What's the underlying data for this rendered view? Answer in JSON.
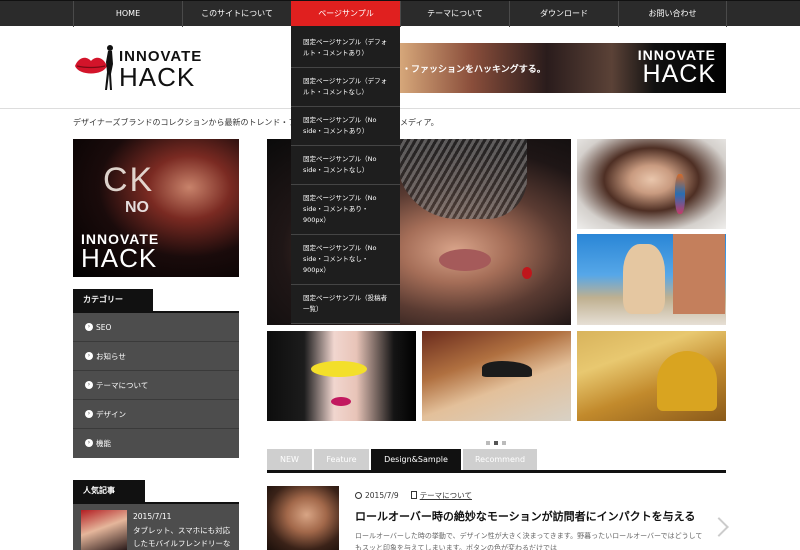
{
  "nav": {
    "items": [
      "HOME",
      "このサイトについて",
      "ページサンプル",
      "テーマについて",
      "ダウンロード",
      "お問い合わせ"
    ]
  },
  "dropdown": {
    "items": [
      "固定ページサンプル（デフォルト・コメントあり）",
      "固定ページサンプル（デフォルト・コメントなし）",
      "固定ページサンプル（No side・コメントあり）",
      "固定ページサンプル（No side・コメントなし）",
      "固定ページサンプル（No side・コメントあり・900px）",
      "固定ページサンプル（No side・コメントなし・900px）",
      "固定ページサンプル（投稿者一覧）"
    ]
  },
  "header": {
    "logo_line1": "INNOVATE",
    "logo_line2": "HACK",
    "banner_tagline": "・ファッションをハッキングする。",
    "banner_line1": "INNOVATE",
    "banner_line2": "HACK"
  },
  "description": {
    "left": "デザイナーズブランドのコレクションから最新のトレンド・ファッ",
    "right": "メディア。"
  },
  "sidebar": {
    "banner": {
      "ck": "CK",
      "no": "NO",
      "line1": "INNOVATE",
      "line2": "HACK"
    },
    "categories_title": "カテゴリー",
    "categories": [
      "SEO",
      "お知らせ",
      "テーマについて",
      "デザイン",
      "機能"
    ],
    "popular_title": "人気記事",
    "popular": {
      "date": "2015/7/11",
      "title": "タブレット、スマホにも対応したモバイルフレンドリーな"
    }
  },
  "tabs": {
    "items": [
      "NEW",
      "Feature",
      "Design&Sample",
      "Recommend"
    ],
    "active_index": 2
  },
  "article": {
    "date": "2015/7/9",
    "category": "テーマについて",
    "title": "ロールオーバー時の絶妙なモーションが訪問者にインパクトを与える",
    "excerpt": "ロールオーバーした時の挙動で、デザイン性が大きく決まってきます。野暮ったいロールオーバーではどうしてもスッと印象を与えてしまいます。ボタンの色が変わるだけでは"
  },
  "colors": {
    "accent": "#e0201f",
    "nav_bg": "#2b2b2b",
    "sidebar_bg": "#4d4d4d",
    "tab_inactive": "#cfcfcf",
    "tab_active": "#111111"
  }
}
